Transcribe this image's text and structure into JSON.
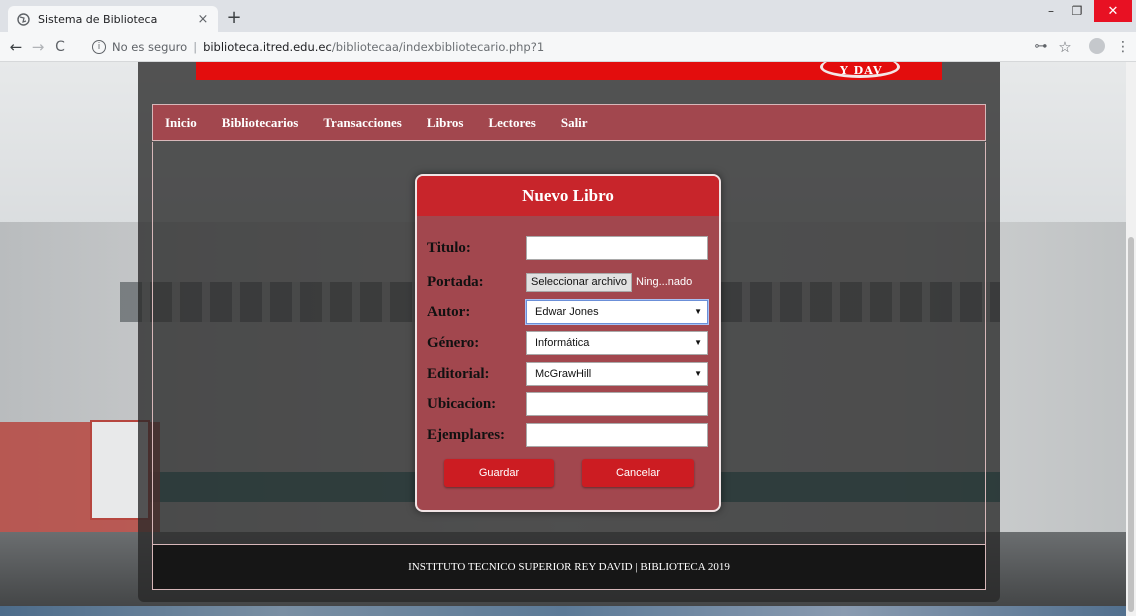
{
  "browser": {
    "tab_title": "Sistema de Biblioteca",
    "tab_close": "×",
    "new_tab": "+",
    "window": {
      "minimize": "–",
      "maximize": "❐",
      "close": "✕"
    },
    "nav": {
      "back": "←",
      "forward": "→",
      "reload": "C"
    },
    "url": {
      "security_label": "No es seguro",
      "separator": "|",
      "host": "biblioteca.itred.edu.ec",
      "path": "/bibliotecaa/indexbibliotecario.php?1"
    },
    "toolbar_icons": {
      "key": "⊶",
      "star": "☆",
      "menu": "⋮"
    }
  },
  "page": {
    "logo_text": "Y DAV",
    "menu": [
      {
        "label": "Inicio"
      },
      {
        "label": "Bibliotecarios"
      },
      {
        "label": "Transacciones"
      },
      {
        "label": "Libros"
      },
      {
        "label": "Lectores"
      },
      {
        "label": "Salir"
      }
    ],
    "form": {
      "title": "Nuevo Libro",
      "titulo": {
        "label": "Titulo:",
        "value": ""
      },
      "portada": {
        "label": "Portada:",
        "button": "Seleccionar archivo",
        "file_status": "Ning...nado"
      },
      "autor": {
        "label": "Autor:",
        "selected": "Edwar Jones"
      },
      "genero": {
        "label": "Género:",
        "selected": "Informática"
      },
      "editorial": {
        "label": "Editorial:",
        "selected": "McGrawHill"
      },
      "ubicacion": {
        "label": "Ubicacion:",
        "value": ""
      },
      "ejemplares": {
        "label": "Ejemplares:",
        "value": ""
      },
      "save_label": "Guardar",
      "cancel_label": "Cancelar"
    },
    "footer": "INSTITUTO TECNICO SUPERIOR REY DAVID | BIBLIOTECA 2019"
  },
  "colors": {
    "menu_bg": "#a2474e",
    "card_header": "#c8252b",
    "button": "#cc1c22",
    "red_band": "#e30d0d"
  }
}
